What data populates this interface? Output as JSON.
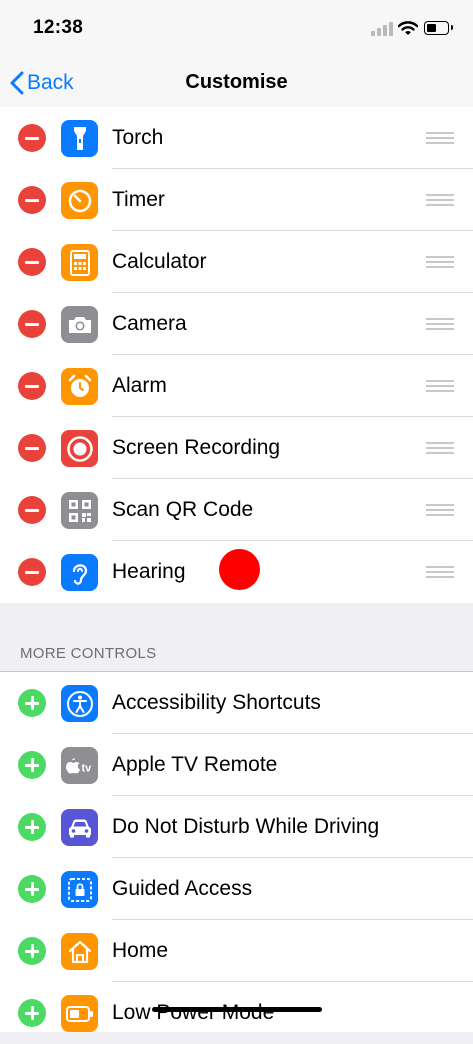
{
  "status_bar": {
    "time": "12:38"
  },
  "nav": {
    "back_label": "Back",
    "title": "Customise"
  },
  "included": [
    {
      "label": "Torch",
      "icon": "flashlight-icon",
      "color": "#0a7aff"
    },
    {
      "label": "Timer",
      "icon": "timer-icon",
      "color": "#ff9500"
    },
    {
      "label": "Calculator",
      "icon": "calculator-icon",
      "color": "#ff9500"
    },
    {
      "label": "Camera",
      "icon": "camera-icon",
      "color": "#8e8e93"
    },
    {
      "label": "Alarm",
      "icon": "alarm-clock-icon",
      "color": "#ff9500"
    },
    {
      "label": "Screen Recording",
      "icon": "record-icon",
      "color": "#e9423a"
    },
    {
      "label": "Scan QR Code",
      "icon": "qr-code-icon",
      "color": "#8e8e93"
    },
    {
      "label": "Hearing",
      "icon": "ear-icon",
      "color": "#0a7aff"
    }
  ],
  "more_controls": {
    "header": "MORE CONTROLS",
    "items": [
      {
        "label": "Accessibility Shortcuts",
        "icon": "accessibility-icon",
        "color": "#0a7aff"
      },
      {
        "label": "Apple TV Remote",
        "icon": "apple-tv-icon",
        "color": "#8e8e93"
      },
      {
        "label": "Do Not Disturb While Driving",
        "icon": "car-icon",
        "color": "#5856d6"
      },
      {
        "label": "Guided Access",
        "icon": "guided-access-lock-icon",
        "color": "#0a7aff"
      },
      {
        "label": "Home",
        "icon": "home-icon",
        "color": "#ff9500"
      },
      {
        "label": "Low Power Mode",
        "icon": "battery-icon",
        "color": "#ff9500"
      }
    ]
  },
  "colors": {
    "accent": "#0a7aff",
    "remove": "#e9423a",
    "add": "#4cd964",
    "touch_indicator": "#fe0000"
  }
}
